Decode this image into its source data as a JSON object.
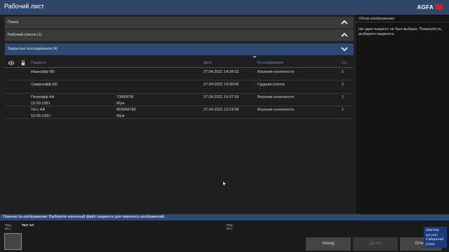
{
  "app": {
    "title": "Рабочий лист",
    "logo_text": "AGFA",
    "colors": {
      "titlebar": "#2f4669",
      "accent": "#2d4b72",
      "logo_mark": "#c0243b",
      "header_text": "#6f88b0"
    }
  },
  "panels": {
    "search": {
      "label": "Поиск",
      "icon": "chevron-up-icon"
    },
    "worklist": {
      "label": "Рабочий список (1)",
      "icon": "chevron-up-icon"
    },
    "closed": {
      "label": "Закрытые исследования (4)",
      "icon": "chevron-down-icon"
    }
  },
  "table": {
    "header_icons": [
      "eye-icon",
      "lock-icon"
    ],
    "columns": {
      "patient": "Пациент",
      "date": "Дата",
      "study": "Исследование",
      "count": "Ск..."
    },
    "rows": [
      {
        "patient": "Иванофф ББ",
        "id": "",
        "birth": "",
        "sex": "",
        "date": "27.04.2022 14:34:32",
        "study": "Верхние конечности",
        "count": "1"
      },
      {
        "patient": "Смирнофф ЕЕ",
        "id": "",
        "birth": "",
        "sex": "",
        "date": "27.04.2022 14:30:06",
        "study": "Грудная клетка",
        "count": "1"
      },
      {
        "patient": "Петрофф АА",
        "id": "7389/879/",
        "birth": "19.09.1991",
        "sex": "Муж",
        "date": "27.04.2022 14:27:53",
        "study": "Верхние конечности",
        "count": "1"
      },
      {
        "patient": "Тест АА",
        "id": "564968789",
        "birth": "19.09.1991",
        "sex": "Муж",
        "date": "27.04.2022 13:14:58",
        "study": "Верхние конечности",
        "count": "1"
      }
    ]
  },
  "overview": {
    "title": "Обзор изображения",
    "message": "Ни один пациент не был выбран. Пожалуйста, выберите пациента."
  },
  "transfer": {
    "text": "Перенести изображение: Выберите конечный файл пациента для переноса изображений."
  },
  "bottom": {
    "left_labels": [
      "Пац.:",
      "Исс.:"
    ],
    "patient_value": "Тест АА",
    "right_labels": [
      "Пац.:",
      "Исс.:"
    ],
    "buttons": {
      "back": "Назад",
      "next": "Далее",
      "cancel": "Отм..."
    }
  },
  "watermark": {
    "lines": [
      "Siberian",
      "success",
      "Сибирский",
      "успех"
    ]
  }
}
